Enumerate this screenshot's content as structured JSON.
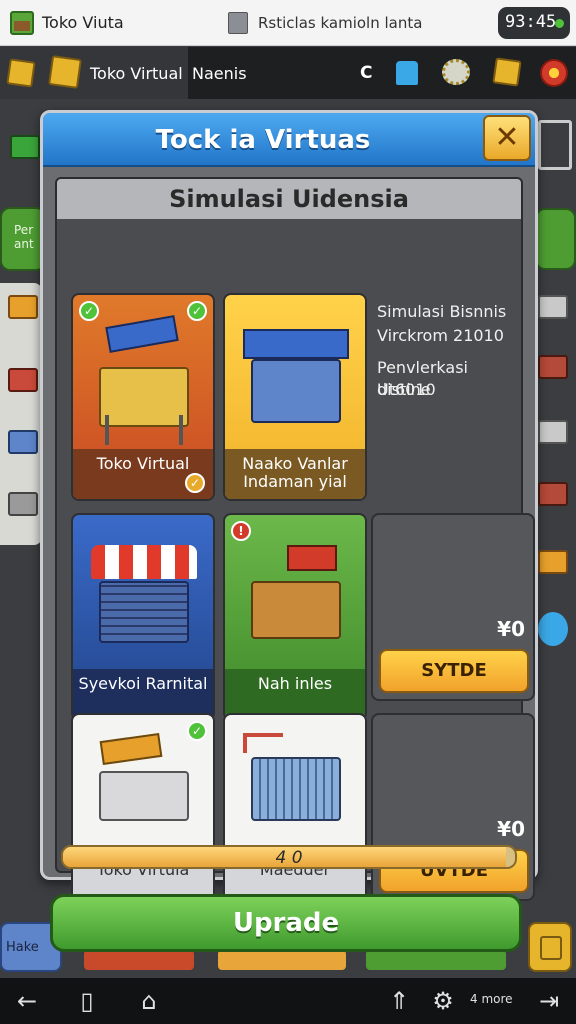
{
  "status_bar": {
    "app_title": "Toko Viuta",
    "center_text": "Rsticlas kamioln lanta",
    "clock": "93:45"
  },
  "top_bar": {
    "title": "Toko Virtual",
    "subtitle": "Naenis",
    "letter": "C"
  },
  "side": {
    "left_green_label": "Per\nant",
    "bottom_left_label": "Hake"
  },
  "modal": {
    "title": "Tock ia Virtuas",
    "close_label": "✕",
    "section_title": "Simulasi Uidensia",
    "info": {
      "line1": "Simulasi Bisnnis",
      "line2": "Virckrom 21010",
      "line3": "Penvlerkasi distine",
      "line4": "Ut6010"
    },
    "cards": [
      {
        "label": "Toko Virtual"
      },
      {
        "label": "Naako Vanlar Indaman yial"
      },
      {
        "label": "Syevkoi Rarnital"
      },
      {
        "label": "Nah inles"
      },
      {
        "label": "Toko Virtula"
      },
      {
        "label": "Maedder"
      }
    ],
    "slots": [
      {
        "price": "¥0",
        "button": "SYTDE"
      },
      {
        "price": "¥0",
        "button": "UVTDE"
      }
    ],
    "progress": {
      "text": "4 0",
      "fraction": 0.98
    }
  },
  "upgrade_button": "Uprade",
  "nav": {
    "more_label": "4 more"
  },
  "colors": {
    "header_blue": "#2276c9",
    "upgrade_green": "#3f9a2e",
    "buy_yellow": "#f1a22a"
  },
  "icons": [
    "app-icon",
    "cube-icon",
    "hat-icon",
    "gears-icon",
    "target-icon",
    "close-icon",
    "check-icon",
    "back-icon",
    "recent-apps-icon",
    "home-icon",
    "chevron-up-icon",
    "gear-icon",
    "exit-icon"
  ]
}
